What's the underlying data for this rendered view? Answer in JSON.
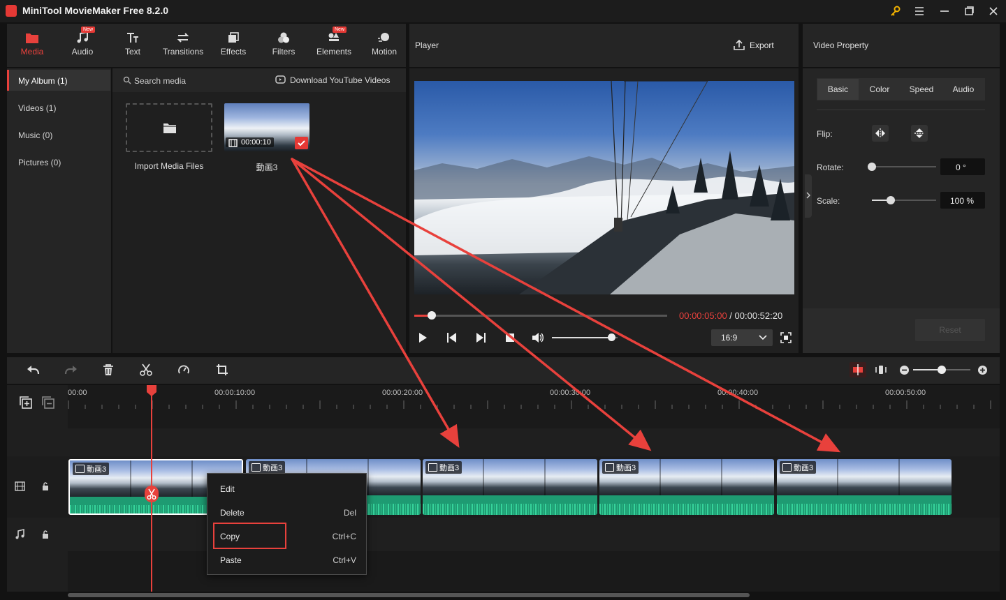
{
  "app": {
    "title": "MiniTool MovieMaker Free 8.2.0"
  },
  "toolbar": {
    "tabs": [
      {
        "label": "Media",
        "icon": "media-folder-icon",
        "active": true
      },
      {
        "label": "Audio",
        "icon": "music-note-icon",
        "badge": "New"
      },
      {
        "label": "Text",
        "icon": "text-icon"
      },
      {
        "label": "Transitions",
        "icon": "transitions-icon"
      },
      {
        "label": "Effects",
        "icon": "effects-icon"
      },
      {
        "label": "Filters",
        "icon": "filters-icon"
      },
      {
        "label": "Elements",
        "icon": "elements-icon",
        "badge": "New"
      },
      {
        "label": "Motion",
        "icon": "motion-icon"
      }
    ]
  },
  "sidebar": {
    "items": [
      {
        "label": "My Album (1)",
        "active": true
      },
      {
        "label": "Videos (1)"
      },
      {
        "label": "Music (0)"
      },
      {
        "label": "Pictures (0)"
      }
    ]
  },
  "media": {
    "search_placeholder": "Search media",
    "download_label": "Download YouTube Videos",
    "import_label": "Import Media Files",
    "file_name": "動画3",
    "file_duration": "00:00:10"
  },
  "player": {
    "title": "Player",
    "export_label": "Export",
    "current_time": "00:00:05:00",
    "separator": " / ",
    "total_time": "00:00:52:20",
    "progress": 0.07,
    "volume": 0.9,
    "aspect_ratio": "16:9"
  },
  "property": {
    "title": "Video Property",
    "tabs": [
      "Basic",
      "Color",
      "Speed",
      "Audio"
    ],
    "active_tab": "Basic",
    "flip_label": "Flip:",
    "rotate_label": "Rotate:",
    "rotate_value": "0 °",
    "rotate_level": 0.0,
    "scale_label": "Scale:",
    "scale_value": "100 %",
    "scale_level": 0.29,
    "reset_label": "Reset"
  },
  "timeline": {
    "ticks": [
      "00:00",
      "00:00:10:00",
      "00:00:20:00",
      "00:00:30:00",
      "00:00:40:00",
      "00:00:50:00"
    ],
    "zoom_level": 0.5,
    "clips": [
      {
        "label": "動画3"
      },
      {
        "label": "動画3"
      },
      {
        "label": "動画3"
      },
      {
        "label": "動画3"
      },
      {
        "label": "動画3"
      }
    ]
  },
  "context_menu": {
    "items": [
      {
        "label": "Edit",
        "shortcut": ""
      },
      {
        "label": "Delete",
        "shortcut": "Del"
      },
      {
        "label": "Copy",
        "shortcut": "Ctrl+C"
      },
      {
        "label": "Paste",
        "shortcut": "Ctrl+V"
      }
    ]
  },
  "colors": {
    "accent": "#e8413c",
    "wave": "#1e9b72",
    "annotation": "#e8413c"
  }
}
